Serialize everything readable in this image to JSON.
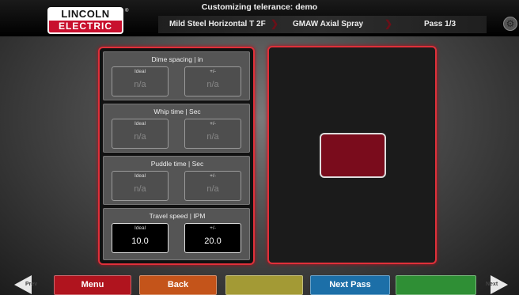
{
  "header": {
    "title": "Customizing telerance: demo",
    "logo": {
      "line1": "LINCOLN",
      "line2": "ELECTRIC",
      "registered": "®"
    },
    "breadcrumbs": [
      {
        "label": "Mild Steel Horizontal T 2F"
      },
      {
        "label": "GMAW Axial Spray"
      },
      {
        "label": "Pass 1/3"
      }
    ],
    "separator": "❯"
  },
  "tolerances": [
    {
      "title": "Dime spacing | in",
      "ideal_label": "Ideal",
      "tol_label": "+/-",
      "ideal_value": "n/a",
      "tol_value": "n/a",
      "active": false
    },
    {
      "title": "Whip time | Sec",
      "ideal_label": "Ideal",
      "tol_label": "+/-",
      "ideal_value": "n/a",
      "tol_value": "n/a",
      "active": false
    },
    {
      "title": "Puddle time | Sec",
      "ideal_label": "Ideal",
      "tol_label": "+/-",
      "ideal_value": "n/a",
      "tol_value": "n/a",
      "active": false
    },
    {
      "title": "Travel speed | IPM",
      "ideal_label": "Ideal",
      "tol_label": "+/-",
      "ideal_value": "10.0",
      "tol_value": "20.0",
      "active": true
    }
  ],
  "preview": {
    "swatch_color": "#7a0c1c"
  },
  "nav": {
    "prev_label": "Prev",
    "next_label": "Next",
    "buttons": [
      {
        "label": "Menu",
        "color": "#b0141e"
      },
      {
        "label": "Back",
        "color": "#c4541a"
      },
      {
        "label": "",
        "color": "#a39a35"
      },
      {
        "label": "Next Pass",
        "color": "#1c6fa8"
      },
      {
        "label": "",
        "color": "#2f8f35"
      }
    ]
  },
  "colors": {
    "accent": "#e0303a",
    "brand_red": "#c8102e"
  }
}
